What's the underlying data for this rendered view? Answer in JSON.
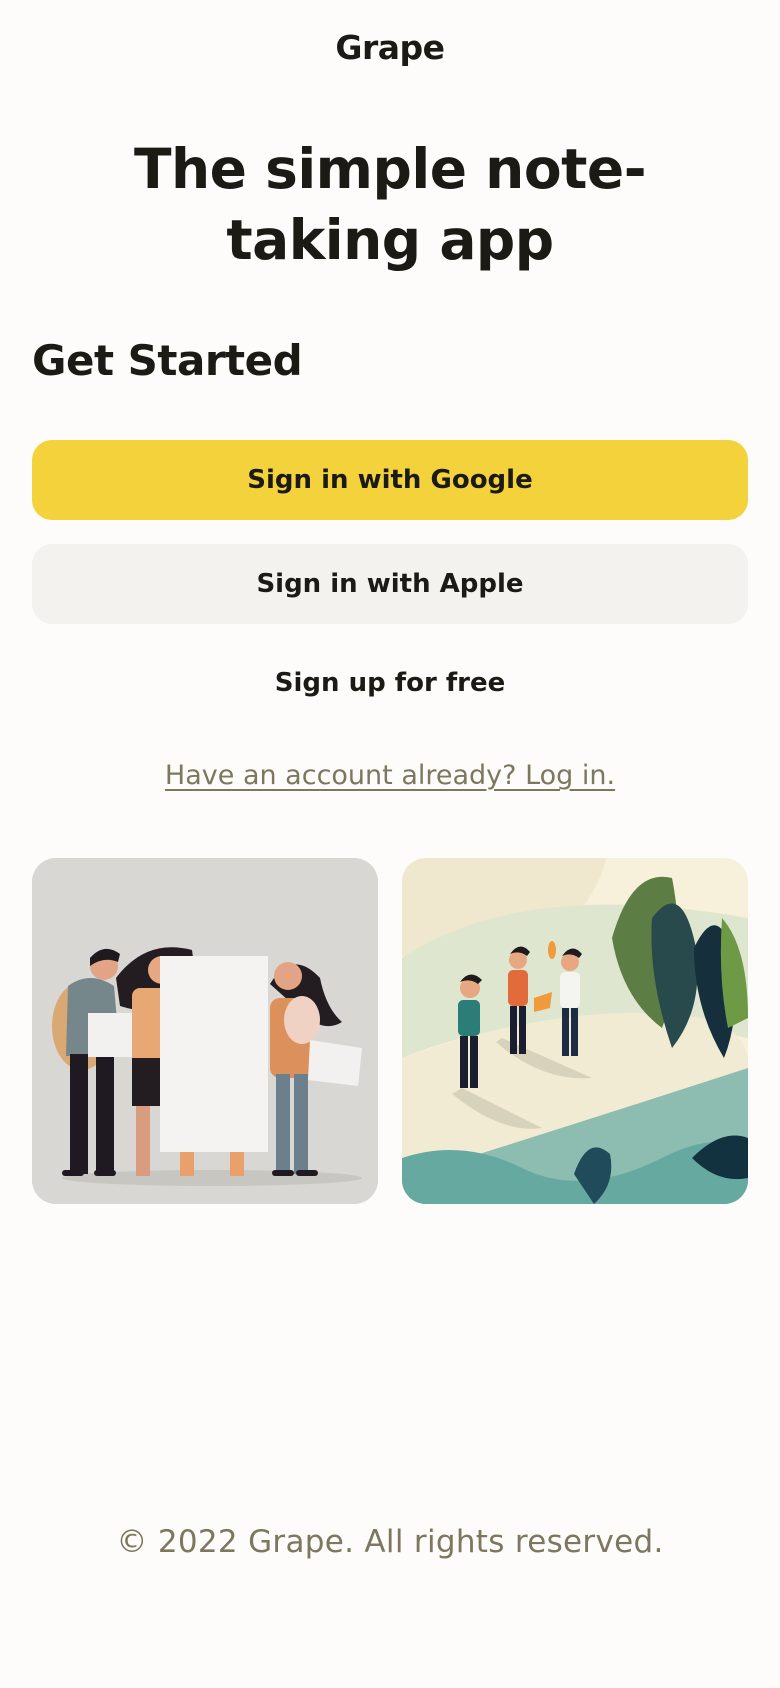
{
  "header": {
    "brand": "Grape"
  },
  "hero": {
    "headline": "The simple note-taking app"
  },
  "auth": {
    "section_title": "Get Started",
    "google_label": "Sign in with Google",
    "apple_label": "Sign in with Apple",
    "signup_label": "Sign up for free",
    "login_link": "Have an account already? Log in."
  },
  "illustrations": [
    {
      "name": "group-holding-signs-illustration"
    },
    {
      "name": "people-on-hill-illustration"
    }
  ],
  "footer": {
    "copyright": "© 2022 Grape. All rights reserved."
  },
  "colors": {
    "accent": "#f3d23c",
    "secondary_button": "#f3f2ee",
    "muted_text": "#7d775f",
    "background": "#fdfcfb",
    "text": "#1b1a14"
  }
}
